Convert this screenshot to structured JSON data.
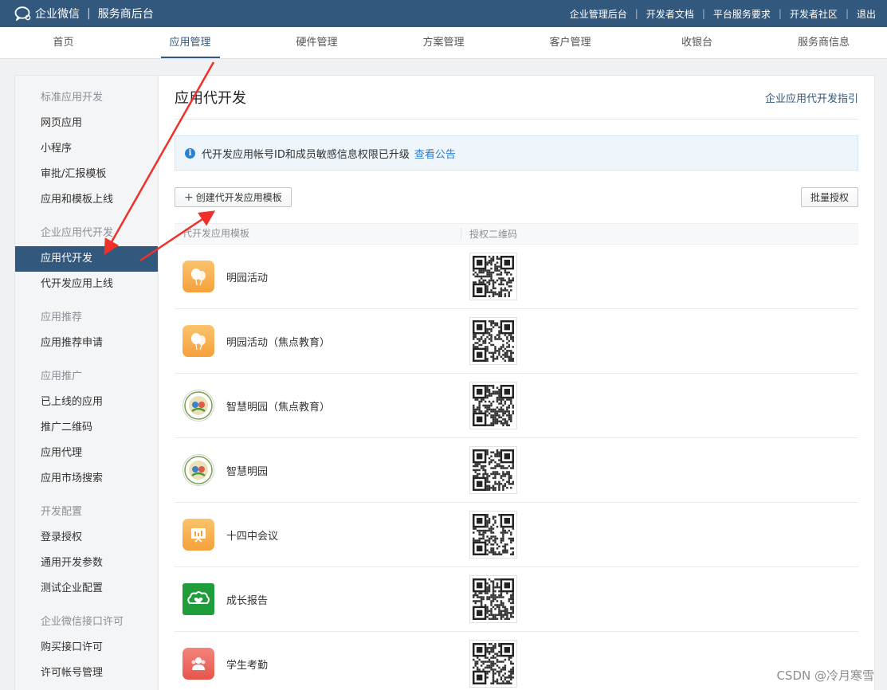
{
  "header": {
    "brand": "企业微信",
    "subtitle": "服务商后台",
    "links": [
      "企业管理后台",
      "开发者文档",
      "平台服务要求",
      "开发者社区",
      "退出"
    ]
  },
  "nav": {
    "tabs": [
      "首页",
      "应用管理",
      "硬件管理",
      "方案管理",
      "客户管理",
      "收银台",
      "服务商信息"
    ],
    "active": "应用管理"
  },
  "sidebar": {
    "groups": [
      {
        "title": "标准应用开发",
        "items": [
          "网页应用",
          "小程序",
          "审批/汇报模板",
          "应用和模板上线"
        ]
      },
      {
        "title": "企业应用代开发",
        "items": [
          "应用代开发",
          "代开发应用上线"
        ]
      },
      {
        "title": "应用推荐",
        "items": [
          "应用推荐申请"
        ]
      },
      {
        "title": "应用推广",
        "items": [
          "已上线的应用",
          "推广二维码",
          "应用代理",
          "应用市场搜索"
        ]
      },
      {
        "title": "开发配置",
        "items": [
          "登录授权",
          "通用开发参数",
          "测试企业配置"
        ]
      },
      {
        "title": "企业微信接口许可",
        "items": [
          "购买接口许可",
          "许可帐号管理"
        ]
      }
    ],
    "active_item": "应用代开发"
  },
  "main": {
    "title": "应用代开发",
    "guide_link": "企业应用代开发指引",
    "notice_text": "代开发应用帐号ID和成员敏感信息权限已升级",
    "notice_link": "查看公告",
    "create_button": "创建代开发应用模板",
    "batch_button": "批量授权",
    "columns": [
      "代开发应用模板",
      "授权二维码"
    ],
    "apps": [
      {
        "name": "明园活动",
        "icon": "balloon-icon",
        "color": "#f7a945"
      },
      {
        "name": "明园活动（焦点教育）",
        "icon": "balloon-icon",
        "color": "#f7a945"
      },
      {
        "name": "智慧明园（焦点教育）",
        "icon": "school-badge-icon",
        "color": "#5a8a3a"
      },
      {
        "name": "智慧明园",
        "icon": "school-badge-icon",
        "color": "#5a8a3a"
      },
      {
        "name": "十四中会议",
        "icon": "presentation-board-icon",
        "color": "#f7a945"
      },
      {
        "name": "成长报告",
        "icon": "heart-cloud-icon",
        "color": "#1f9d3a"
      },
      {
        "name": "学生考勤",
        "icon": "people-icon",
        "color": "#e8625a"
      }
    ]
  },
  "watermark": "CSDN @冷月寒雪",
  "accent_color": "#33587e"
}
